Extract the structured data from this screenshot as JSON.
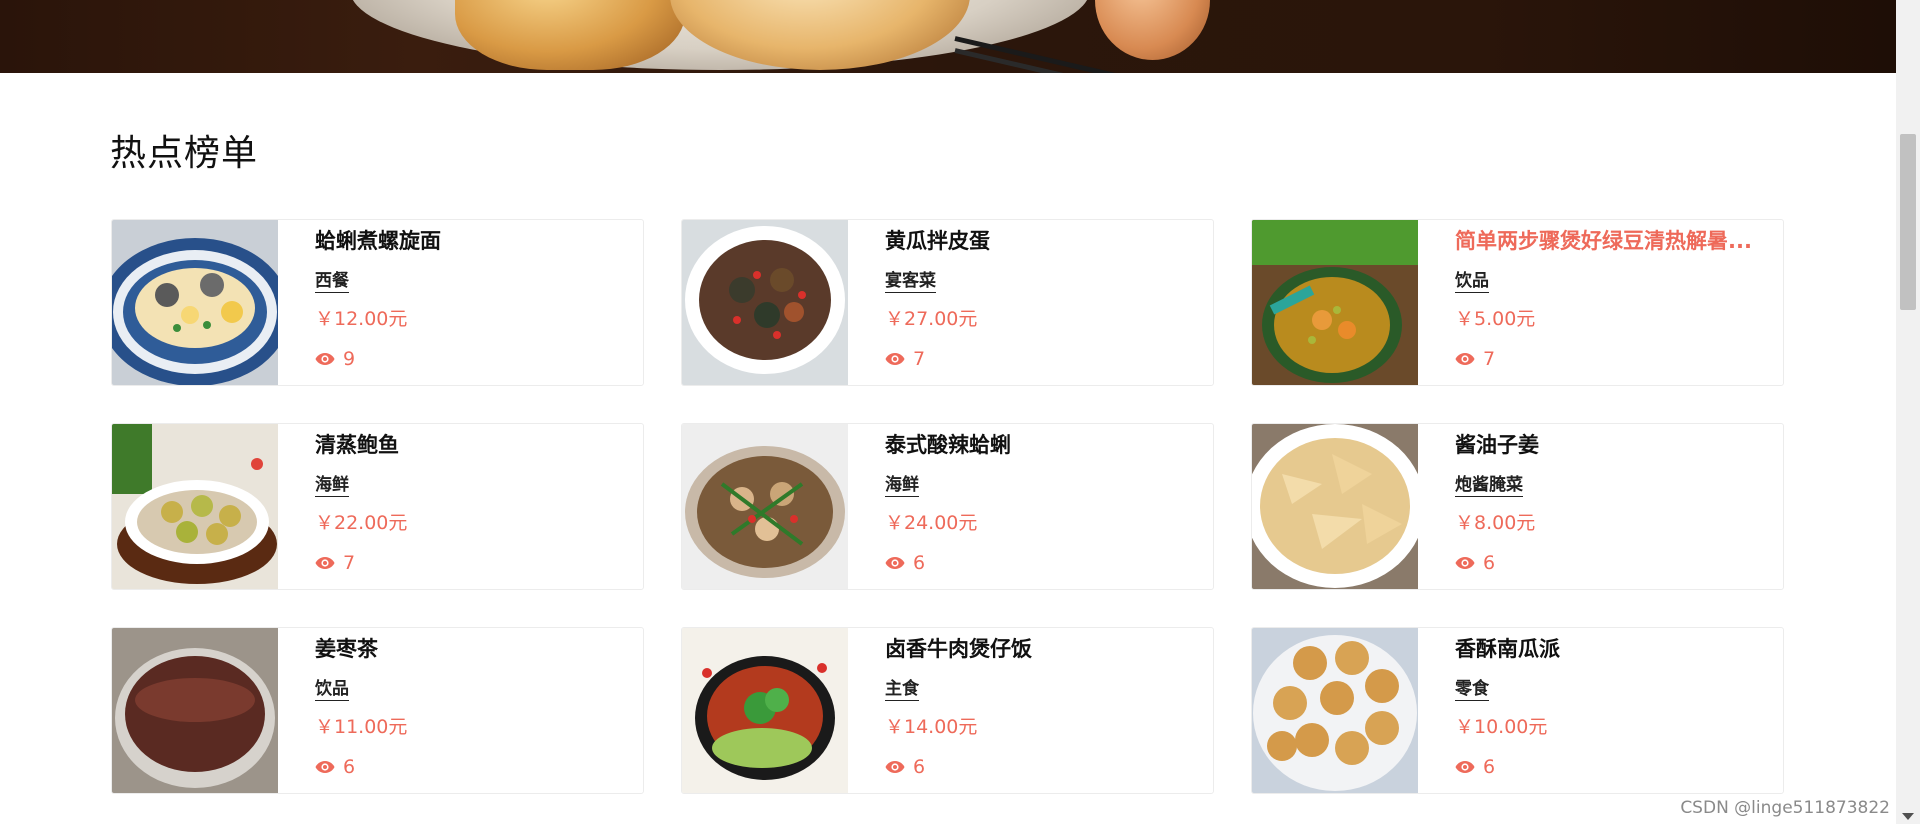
{
  "section": {
    "title": "热点榜单"
  },
  "dishes": [
    {
      "name": "蛤蜊煮螺旋面",
      "category": "西餐",
      "price": "￥12.00元",
      "views": "9"
    },
    {
      "name": "黄瓜拌皮蛋",
      "category": "宴客菜",
      "price": "￥27.00元",
      "views": "7"
    },
    {
      "name": "简单两步骤煲好绿豆清热解暑...",
      "category": "饮品",
      "price": "￥5.00元",
      "views": "7"
    },
    {
      "name": "清蒸鲍鱼",
      "category": "海鲜",
      "price": "￥22.00元",
      "views": "7"
    },
    {
      "name": "泰式酸辣蛤蜊",
      "category": "海鲜",
      "price": "￥24.00元",
      "views": "6"
    },
    {
      "name": "酱油子姜",
      "category": "炮酱腌菜",
      "price": "￥8.00元",
      "views": "6"
    },
    {
      "name": "姜枣茶",
      "category": "饮品",
      "price": "￥11.00元",
      "views": "6"
    },
    {
      "name": "卤香牛肉煲仔饭",
      "category": "主食",
      "price": "￥14.00元",
      "views": "6"
    },
    {
      "name": "香酥南瓜派",
      "category": "零食",
      "price": "￥10.00元",
      "views": "6"
    }
  ],
  "watermark": "CSDN @linge511873822",
  "colors": {
    "accent": "#ee6a5a",
    "text": "#111111",
    "border": "#ececec"
  },
  "icons": {
    "views": "eye-icon"
  }
}
